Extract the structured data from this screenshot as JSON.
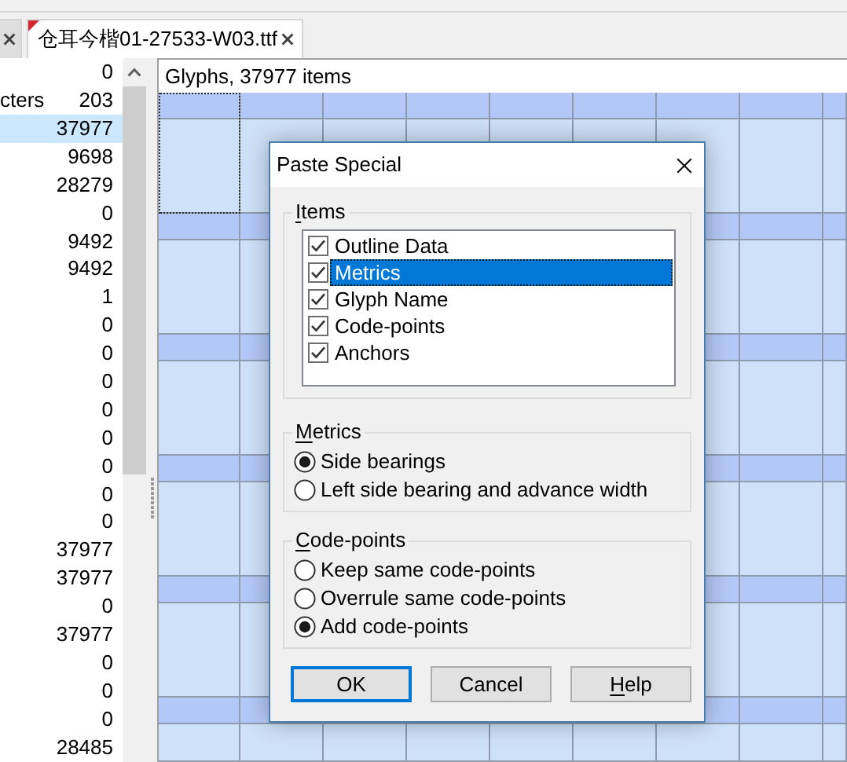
{
  "tabs": [
    {
      "selected": false
    },
    {
      "label": "仓耳今楷01-27533-W03.ttf",
      "selected": true,
      "marked": true
    }
  ],
  "counts": [
    {
      "count": "0",
      "selected": false
    },
    {
      "label": "cters",
      "count": "203",
      "selected": false
    },
    {
      "count": "37977",
      "selected": true
    },
    {
      "count": "9698",
      "selected": false
    },
    {
      "count": "28279",
      "selected": false
    },
    {
      "count": "0",
      "selected": false
    },
    {
      "count": "9492",
      "selected": false
    },
    {
      "count": "9492",
      "selected": false
    },
    {
      "count": "1",
      "selected": false
    },
    {
      "count": "0",
      "selected": false
    },
    {
      "count": "0",
      "selected": false
    },
    {
      "count": "0",
      "selected": false
    },
    {
      "count": "0",
      "selected": false
    },
    {
      "count": "0",
      "selected": false
    },
    {
      "count": "0",
      "selected": false
    },
    {
      "count": "0",
      "selected": false
    },
    {
      "count": "0",
      "selected": false
    },
    {
      "count": "37977",
      "selected": false
    },
    {
      "count": "37977",
      "selected": false
    },
    {
      "count": "0",
      "selected": false
    },
    {
      "count": "37977",
      "selected": false
    },
    {
      "count": "0",
      "selected": false
    },
    {
      "count": "0",
      "selected": false
    },
    {
      "count": "0",
      "selected": false
    },
    {
      "count": "28485",
      "selected": false
    }
  ],
  "glyph_panel": {
    "title": "Glyphs, 37977 items",
    "first_cell_selected": true
  },
  "dialog": {
    "title": "Paste Special",
    "groups": [
      {
        "kind": "checklist",
        "legend": "Items",
        "underlined_initial": true,
        "items": [
          {
            "label": "Outline Data",
            "checked": true,
            "selected": false
          },
          {
            "label": "Metrics",
            "checked": true,
            "selected": true
          },
          {
            "label": "Glyph Name",
            "checked": true,
            "selected": false
          },
          {
            "label": "Code-points",
            "checked": true,
            "selected": false
          },
          {
            "label": "Anchors",
            "checked": true,
            "selected": false
          }
        ]
      },
      {
        "kind": "radio",
        "legend": "Metrics",
        "underlined_initial": true,
        "items": [
          {
            "label": "Side bearings",
            "selected": true
          },
          {
            "label": "Left side bearing and advance width",
            "selected": false
          }
        ]
      },
      {
        "kind": "radio",
        "legend": "Code-points",
        "underlined_initial": true,
        "items": [
          {
            "label": "Keep same code-points",
            "selected": false
          },
          {
            "label": "Overrule same code-points",
            "selected": false
          },
          {
            "label": "Add code-points",
            "selected": true
          }
        ]
      }
    ],
    "buttons": [
      {
        "label": "OK",
        "default": true,
        "underlined_initial": false
      },
      {
        "label": "Cancel",
        "default": false,
        "underlined_initial": false
      },
      {
        "label": "Help",
        "default": false,
        "underlined_initial": true
      }
    ]
  }
}
